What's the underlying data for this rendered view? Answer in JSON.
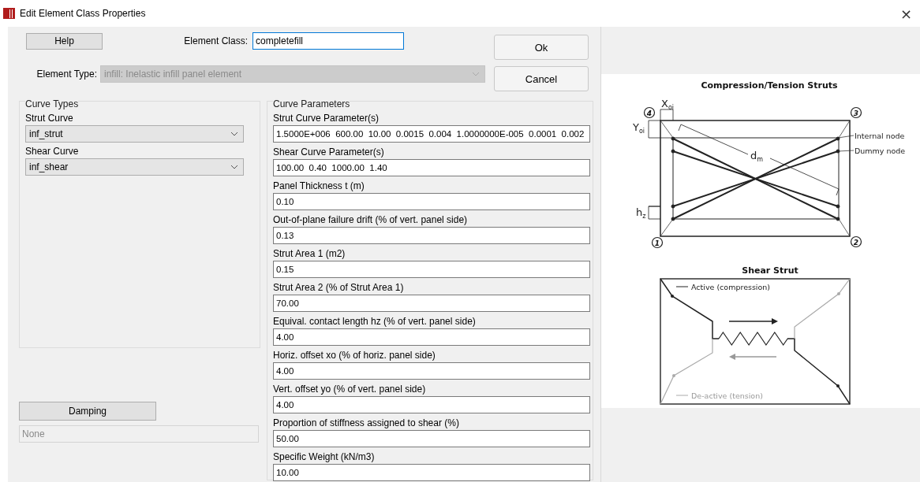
{
  "window": {
    "title": "Edit Element Class Properties",
    "close": "×"
  },
  "help_button": "Help",
  "element_class": {
    "label": "Element Class:",
    "value": "completefill"
  },
  "element_type": {
    "label": "Element Type:",
    "value": "infill: Inelastic infill panel element",
    "disabled": true
  },
  "buttons": [
    "Ok",
    "Cancel"
  ],
  "curve_types": {
    "title": "Curve Types",
    "items": [
      {
        "label": "Strut Curve",
        "value": "inf_strut"
      },
      {
        "label": "Shear Curve",
        "value": "inf_shear"
      }
    ]
  },
  "curve_parameters": {
    "title": "Curve Parameters",
    "fields": [
      {
        "label": "Strut Curve Parameter(s)",
        "value": "1.5000E+006  600.00  10.00  0.0015  0.004  1.0000000E-005  0.0001  0.002"
      },
      {
        "label": "Shear Curve Parameter(s)",
        "value": "100.00  0.40  1000.00  1.40"
      },
      {
        "label": "Panel Thickness t (m)",
        "value": "0.10"
      },
      {
        "label": "Out-of-plane failure drift (% of vert. panel side)",
        "value": "0.13"
      },
      {
        "label": "Strut Area 1 (m2)",
        "value": "0.15"
      },
      {
        "label": "Strut Area 2 (% of Strut Area 1)",
        "value": "70.00"
      },
      {
        "label": "Equival. contact length hz (% of vert. panel side)",
        "value": "4.00"
      },
      {
        "label": "Horiz. offset xo (% of horiz. panel side)",
        "value": "4.00"
      },
      {
        "label": "Vert. offset yo (% of vert. panel side)",
        "value": "4.00"
      },
      {
        "label": "Proportion of stiffness assigned to shear (%)",
        "value": "50.00"
      },
      {
        "label": "Specific Weight (kN/m3)",
        "value": "10.00"
      }
    ]
  },
  "damping": {
    "button": "Damping",
    "value": "None",
    "disabled": true
  },
  "struts_diagram": {
    "title": "Compression/Tension Struts",
    "node_numbers": [
      "4",
      "3",
      "1",
      "2"
    ],
    "x_offset": {
      "main": "X",
      "sub": "oi"
    },
    "y_offset": {
      "main": "Y",
      "sub": "oi"
    },
    "diagonal": {
      "main": "d",
      "sub": "m"
    },
    "contact": {
      "main": "h",
      "sub": "z"
    },
    "internal_node": "Internal node",
    "dummy_node": "Dummy node"
  },
  "shear_diagram": {
    "title": "Shear Strut",
    "active": "Active (compression)",
    "deactive": "De-active (tension)"
  }
}
